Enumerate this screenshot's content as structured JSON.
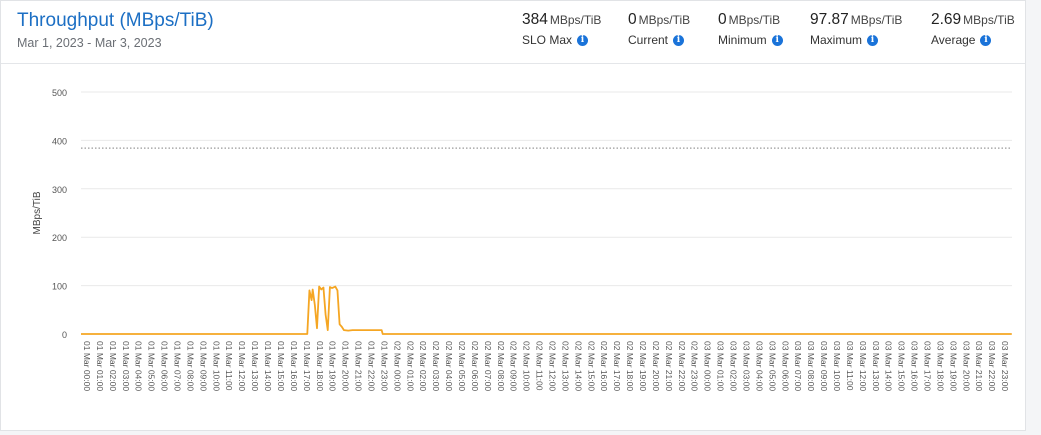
{
  "header": {
    "title": "Throughput (MBps/TiB)",
    "date_range": "Mar 1, 2023 - Mar 3, 2023"
  },
  "stats": [
    {
      "value": "384",
      "unit": "MBps/TiB",
      "label": "SLO Max"
    },
    {
      "value": "0",
      "unit": "MBps/TiB",
      "label": "Current"
    },
    {
      "value": "0",
      "unit": "MBps/TiB",
      "label": "Minimum"
    },
    {
      "value": "97.87",
      "unit": "MBps/TiB",
      "label": "Maximum"
    },
    {
      "value": "2.69",
      "unit": "MBps/TiB",
      "label": "Average"
    }
  ],
  "colors": {
    "accent": "#1c6fc4",
    "info_icon": "#1a73d9",
    "series": "#f5a623",
    "slo_line": "#9a9a9a",
    "grid": "#e9e9e9"
  },
  "chart_data": {
    "type": "line",
    "ylabel": "MBps/TiB",
    "ylim": [
      0,
      500
    ],
    "yticks": [
      0,
      100,
      200,
      300,
      400,
      500
    ],
    "grid": true,
    "reference_line": {
      "value": 384,
      "style": "dotted"
    },
    "x_ticks": [
      "01 Mar 00:00",
      "01 Mar 01:00",
      "01 Mar 02:00",
      "01 Mar 03:00",
      "01 Mar 04:00",
      "01 Mar 05:00",
      "01 Mar 06:00",
      "01 Mar 07:00",
      "01 Mar 08:00",
      "01 Mar 09:00",
      "01 Mar 10:00",
      "01 Mar 11:00",
      "01 Mar 12:00",
      "01 Mar 13:00",
      "01 Mar 14:00",
      "01 Mar 15:00",
      "01 Mar 16:00",
      "01 Mar 17:00",
      "01 Mar 18:00",
      "01 Mar 19:00",
      "01 Mar 20:00",
      "01 Mar 21:00",
      "01 Mar 22:00",
      "01 Mar 23:00",
      "02 Mar 00:00",
      "02 Mar 01:00",
      "02 Mar 02:00",
      "02 Mar 03:00",
      "02 Mar 04:00",
      "02 Mar 05:00",
      "02 Mar 06:00",
      "02 Mar 07:00",
      "02 Mar 08:00",
      "02 Mar 09:00",
      "02 Mar 10:00",
      "02 Mar 11:00",
      "02 Mar 12:00",
      "02 Mar 13:00",
      "02 Mar 14:00",
      "02 Mar 15:00",
      "02 Mar 16:00",
      "02 Mar 17:00",
      "02 Mar 18:00",
      "02 Mar 19:00",
      "02 Mar 20:00",
      "02 Mar 21:00",
      "02 Mar 22:00",
      "02 Mar 23:00",
      "03 Mar 00:00",
      "03 Mar 01:00",
      "03 Mar 02:00",
      "03 Mar 03:00",
      "03 Mar 04:00",
      "03 Mar 05:00",
      "03 Mar 06:00",
      "03 Mar 07:00",
      "03 Mar 08:00",
      "03 Mar 09:00",
      "03 Mar 10:00",
      "03 Mar 11:00",
      "03 Mar 12:00",
      "03 Mar 13:00",
      "03 Mar 14:00",
      "03 Mar 15:00",
      "03 Mar 16:00",
      "03 Mar 17:00",
      "03 Mar 18:00",
      "03 Mar 19:00",
      "03 Mar 20:00",
      "03 Mar 21:00",
      "03 Mar 22:00",
      "03 Mar 23:00"
    ],
    "series": [
      {
        "points": [
          {
            "x": "01 Mar 00:00",
            "y": 0
          },
          {
            "x": "01 Mar 17:30",
            "y": 0
          },
          {
            "x": "01 Mar 17:40",
            "y": 90
          },
          {
            "x": "01 Mar 17:50",
            "y": 70
          },
          {
            "x": "01 Mar 17:55",
            "y": 92
          },
          {
            "x": "01 Mar 18:05",
            "y": 60
          },
          {
            "x": "01 Mar 18:15",
            "y": 12
          },
          {
            "x": "01 Mar 18:25",
            "y": 98
          },
          {
            "x": "01 Mar 18:35",
            "y": 92
          },
          {
            "x": "01 Mar 18:45",
            "y": 96
          },
          {
            "x": "01 Mar 18:55",
            "y": 40
          },
          {
            "x": "01 Mar 19:05",
            "y": 8
          },
          {
            "x": "01 Mar 19:15",
            "y": 97
          },
          {
            "x": "01 Mar 19:25",
            "y": 95
          },
          {
            "x": "01 Mar 19:40",
            "y": 98
          },
          {
            "x": "01 Mar 19:50",
            "y": 90
          },
          {
            "x": "01 Mar 20:00",
            "y": 20
          },
          {
            "x": "01 Mar 20:10",
            "y": 15
          },
          {
            "x": "01 Mar 20:20",
            "y": 8
          },
          {
            "x": "01 Mar 20:40",
            "y": 7
          },
          {
            "x": "01 Mar 21:00",
            "y": 8
          },
          {
            "x": "01 Mar 22:00",
            "y": 8
          },
          {
            "x": "01 Mar 23:00",
            "y": 8
          },
          {
            "x": "01 Mar 23:15",
            "y": 8
          },
          {
            "x": "01 Mar 23:20",
            "y": 0
          },
          {
            "x": "03 Mar 23:59",
            "y": 0
          }
        ]
      }
    ]
  }
}
